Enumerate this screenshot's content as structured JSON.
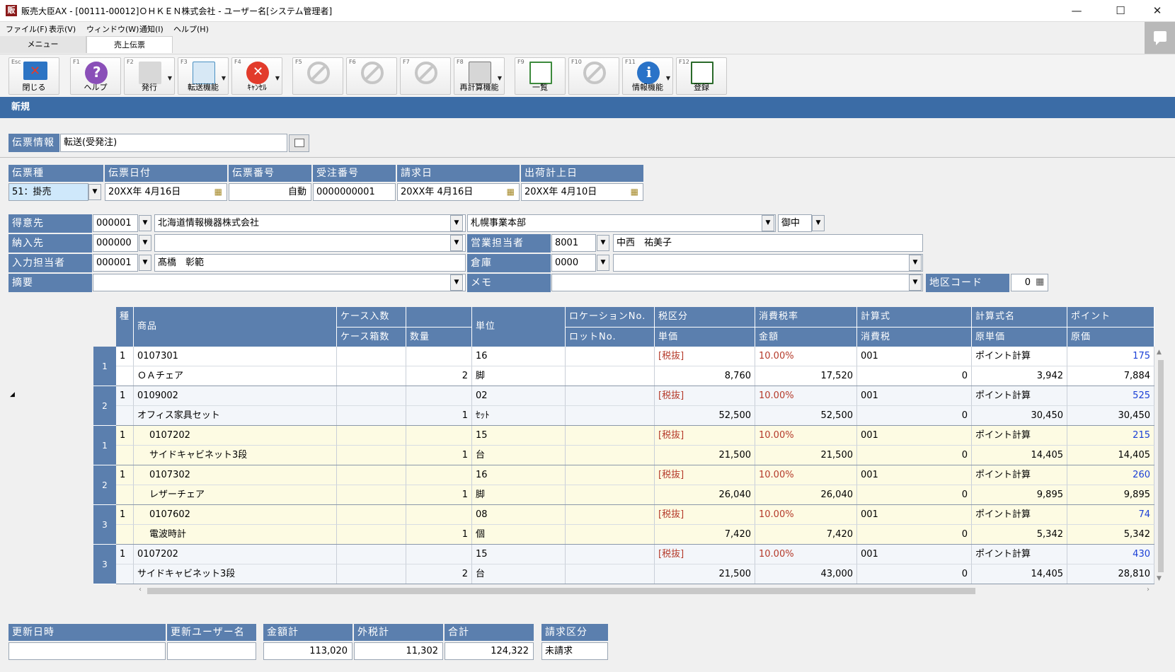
{
  "window": {
    "title": "販売大臣AX - [00111-00012]ＯＨＫＥＮ株式会社 - ユーザー名[システム管理者]",
    "icon": "販"
  },
  "menu": [
    "ファイル(F)",
    "表示(V)",
    "ウィンドウ(W)",
    "通知(I)",
    "ヘルプ(H)"
  ],
  "tabs": [
    "メニュー",
    "売上伝票"
  ],
  "toolbar": [
    {
      "key": "Esc",
      "label": "閉じる",
      "icon": "close-icon",
      "arrow": false
    },
    {
      "key": "F1",
      "label": "ヘルプ",
      "icon": "help-icon",
      "arrow": false
    },
    {
      "key": "F2",
      "label": "発行",
      "icon": "print-icon",
      "arrow": true
    },
    {
      "key": "F3",
      "label": "転送機能",
      "icon": "transfer-icon",
      "arrow": true
    },
    {
      "key": "F4",
      "label": "ｷｬﾝｾﾙ",
      "icon": "cancel-icon",
      "arrow": true
    },
    {
      "key": "F5",
      "label": "",
      "icon": "disabled-icon",
      "arrow": false
    },
    {
      "key": "F6",
      "label": "",
      "icon": "disabled-icon",
      "arrow": false
    },
    {
      "key": "F7",
      "label": "",
      "icon": "disabled-icon",
      "arrow": false
    },
    {
      "key": "F8",
      "label": "再計算機能",
      "icon": "calculator-icon",
      "arrow": true
    },
    {
      "key": "F9",
      "label": "一覧",
      "icon": "list-icon",
      "arrow": false
    },
    {
      "key": "F10",
      "label": "",
      "icon": "disabled-icon",
      "arrow": false
    },
    {
      "key": "F11",
      "label": "情報機能",
      "icon": "info-icon",
      "arrow": true
    },
    {
      "key": "F12",
      "label": "登録",
      "icon": "register-icon",
      "arrow": false
    }
  ],
  "section": "新規",
  "slip_info": {
    "label": "伝票情報",
    "value": "転送(受発注)"
  },
  "header": {
    "slip_type": {
      "label": "伝票種",
      "value": "51：掛売"
    },
    "slip_date": {
      "label": "伝票日付",
      "value": "20XX年 4月16日"
    },
    "slip_no": {
      "label": "伝票番号",
      "value": "自動"
    },
    "order_no": {
      "label": "受注番号",
      "value": "0000000001"
    },
    "billing_date": {
      "label": "請求日",
      "value": "20XX年 4月16日"
    },
    "ship_date": {
      "label": "出荷計上日",
      "value": "20XX年 4月10日"
    }
  },
  "customer": {
    "label": "得意先",
    "code": "000001",
    "name": "北海道情報機器株式会社",
    "dept": "札幌事業本部",
    "honorific": "御中"
  },
  "delivery": {
    "label": "納入先",
    "code": "000000",
    "name": ""
  },
  "sales_rep": {
    "label": "営業担当者",
    "code": "8001",
    "name": "中西　祐美子"
  },
  "entry_user": {
    "label": "入力担当者",
    "code": "000001",
    "name": "髙橋　彰範"
  },
  "warehouse": {
    "label": "倉庫",
    "code": "0000",
    "name": ""
  },
  "summary": {
    "label": "摘要",
    "value": ""
  },
  "memo": {
    "label": "メモ",
    "value": ""
  },
  "area_code": {
    "label": "地区コード",
    "value": "0"
  },
  "grid": {
    "headers_top": [
      "種",
      "商品",
      "ケース入数",
      "",
      "単位",
      "ロケーションNo.",
      "税区分",
      "消費税率",
      "計算式",
      "計算式名",
      "ポイント"
    ],
    "headers_bottom": [
      "ケース箱数",
      "数量",
      "ロットNo.",
      "単価",
      "金額",
      "消費税",
      "原単価",
      "原価"
    ],
    "rows": [
      {
        "num": "1",
        "kind": "1",
        "code": "0107301",
        "name": "ＯＡチェア",
        "qty": "2",
        "unit_code": "16",
        "unit": "脚",
        "tax_cat": "[税抜]",
        "tax_rate": "10.00%",
        "formula": "001",
        "formula_name": "ポイント計算",
        "point": "175",
        "price": "8,760",
        "amount": "17,520",
        "tax": "0",
        "cost_unit": "3,942",
        "cost": "7,884",
        "set": false
      },
      {
        "num": "2",
        "kind": "1",
        "code": "0109002",
        "name": "オフィス家具セット",
        "qty": "1",
        "unit_code": "02",
        "unit": "ｾｯﾄ",
        "tax_cat": "[税抜]",
        "tax_rate": "10.00%",
        "formula": "001",
        "formula_name": "ポイント計算",
        "point": "525",
        "price": "52,500",
        "amount": "52,500",
        "tax": "0",
        "cost_unit": "30,450",
        "cost": "30,450",
        "set": false
      },
      {
        "num": "1",
        "kind": "1",
        "code": "0107202",
        "name": "サイドキャビネット3段",
        "qty": "1",
        "unit_code": "15",
        "unit": "台",
        "tax_cat": "[税抜]",
        "tax_rate": "10.00%",
        "formula": "001",
        "formula_name": "ポイント計算",
        "point": "215",
        "price": "21,500",
        "amount": "21,500",
        "tax": "0",
        "cost_unit": "14,405",
        "cost": "14,405",
        "set": true
      },
      {
        "num": "2",
        "kind": "1",
        "code": "0107302",
        "name": "レザーチェア",
        "qty": "1",
        "unit_code": "16",
        "unit": "脚",
        "tax_cat": "[税抜]",
        "tax_rate": "10.00%",
        "formula": "001",
        "formula_name": "ポイント計算",
        "point": "260",
        "price": "26,040",
        "amount": "26,040",
        "tax": "0",
        "cost_unit": "9,895",
        "cost": "9,895",
        "set": true
      },
      {
        "num": "3",
        "kind": "1",
        "code": "0107602",
        "name": "電波時計",
        "qty": "1",
        "unit_code": "08",
        "unit": "個",
        "tax_cat": "[税抜]",
        "tax_rate": "10.00%",
        "formula": "001",
        "formula_name": "ポイント計算",
        "point": "74",
        "price": "7,420",
        "amount": "7,420",
        "tax": "0",
        "cost_unit": "5,342",
        "cost": "5,342",
        "set": true
      },
      {
        "num": "3",
        "kind": "1",
        "code": "0107202",
        "name": "サイドキャビネット3段",
        "qty": "2",
        "unit_code": "15",
        "unit": "台",
        "tax_cat": "[税抜]",
        "tax_rate": "10.00%",
        "formula": "001",
        "formula_name": "ポイント計算",
        "point": "430",
        "price": "21,500",
        "amount": "43,000",
        "tax": "0",
        "cost_unit": "14,405",
        "cost": "28,810",
        "set": false
      }
    ]
  },
  "footer": {
    "updated_at": {
      "label": "更新日時",
      "value": ""
    },
    "updated_by": {
      "label": "更新ユーザー名",
      "value": ""
    },
    "amount_total": {
      "label": "金額計",
      "value": "113,020"
    },
    "tax_total": {
      "label": "外税計",
      "value": "11,302"
    },
    "grand_total": {
      "label": "合計",
      "value": "124,322"
    },
    "billing_status": {
      "label": "請求区分",
      "value": "未請求"
    }
  }
}
